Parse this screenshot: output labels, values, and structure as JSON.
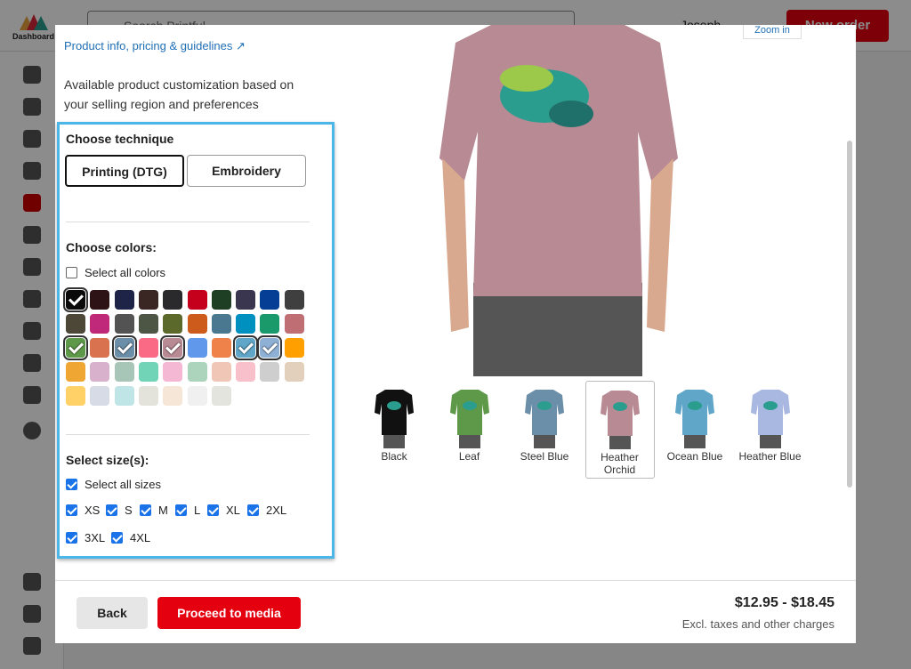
{
  "app": {
    "logo_label": "Dashboard",
    "search_placeholder": "Search Printful",
    "user": "Joseph",
    "new_order": "New order"
  },
  "modal": {
    "product_link": "Product info, pricing & guidelines",
    "zoom_label": "Zoom in",
    "intro": "Available product customization based on your selling region and preferences",
    "technique": {
      "heading": "Choose technique",
      "options": [
        {
          "label": "Printing (DTG)",
          "selected": true
        },
        {
          "label": "Embroidery",
          "selected": false
        }
      ]
    },
    "colors": {
      "heading": "Choose colors:",
      "select_all": "Select all colors",
      "select_all_checked": false,
      "swatches": [
        [
          "#0a0a0a",
          "#2e1316",
          "#1e2448",
          "#3a2723",
          "#2a2a2c",
          "#c4001d",
          "#1f3f24",
          "#3a3650",
          "#053f95",
          "#3f3f3f"
        ],
        [
          "#4c4737",
          "#c0287a",
          "#535353",
          "#4d5645",
          "#5b6a2b",
          "#cc5b1c",
          "#4a7891",
          "#0090bf",
          "#1a9a6a",
          "#bf6e73"
        ],
        [
          "#5e9949",
          "#d9724f",
          "#6b8fa8",
          "#fb6a85",
          "#b88a94",
          "#6099ec",
          "#ef814a",
          "#5fa6c9",
          "#8fb0d5",
          "#ffa000"
        ],
        [
          "#f0a633",
          "#d8b2cd",
          "#a8c6b8",
          "#72d4b6",
          "#f4b8d4",
          "#acd4bc",
          "#f0c6b6",
          "#f8c0ca",
          "#cecece",
          "#e2d0bc"
        ],
        [
          "#ffd166",
          "#d6dbe6",
          "#bfe5e6",
          "#e3e3dc",
          "#f6e6d8",
          "#f0f0f0",
          "#e4e4de"
        ]
      ],
      "selected": [
        [
          0,
          0
        ],
        [
          2,
          0
        ],
        [
          2,
          2
        ],
        [
          2,
          4
        ],
        [
          2,
          7
        ],
        [
          2,
          8
        ]
      ]
    },
    "sizes": {
      "heading": "Select size(s):",
      "select_all": "Select all sizes",
      "select_all_checked": true,
      "items": [
        {
          "label": "XS",
          "checked": true
        },
        {
          "label": "S",
          "checked": true
        },
        {
          "label": "M",
          "checked": true
        },
        {
          "label": "L",
          "checked": true
        },
        {
          "label": "XL",
          "checked": true
        },
        {
          "label": "2XL",
          "checked": true
        },
        {
          "label": "3XL",
          "checked": true
        },
        {
          "label": "4XL",
          "checked": true
        }
      ]
    },
    "preview_color": "#b88a94",
    "thumbnails": [
      {
        "label": "Black",
        "color": "#111111"
      },
      {
        "label": "Leaf",
        "color": "#5e9949"
      },
      {
        "label": "Steel Blue",
        "color": "#6b8fa8"
      },
      {
        "label": "Heather Orchid",
        "color": "#b88a94",
        "selected": true
      },
      {
        "label": "Ocean Blue",
        "color": "#5fa6c9"
      },
      {
        "label": "Heather Blue",
        "color": "#a9b8e0"
      }
    ],
    "footer": {
      "back": "Back",
      "proceed": "Proceed to media",
      "price": "$12.95 - $18.45",
      "price_note": "Excl. taxes and other charges"
    }
  }
}
